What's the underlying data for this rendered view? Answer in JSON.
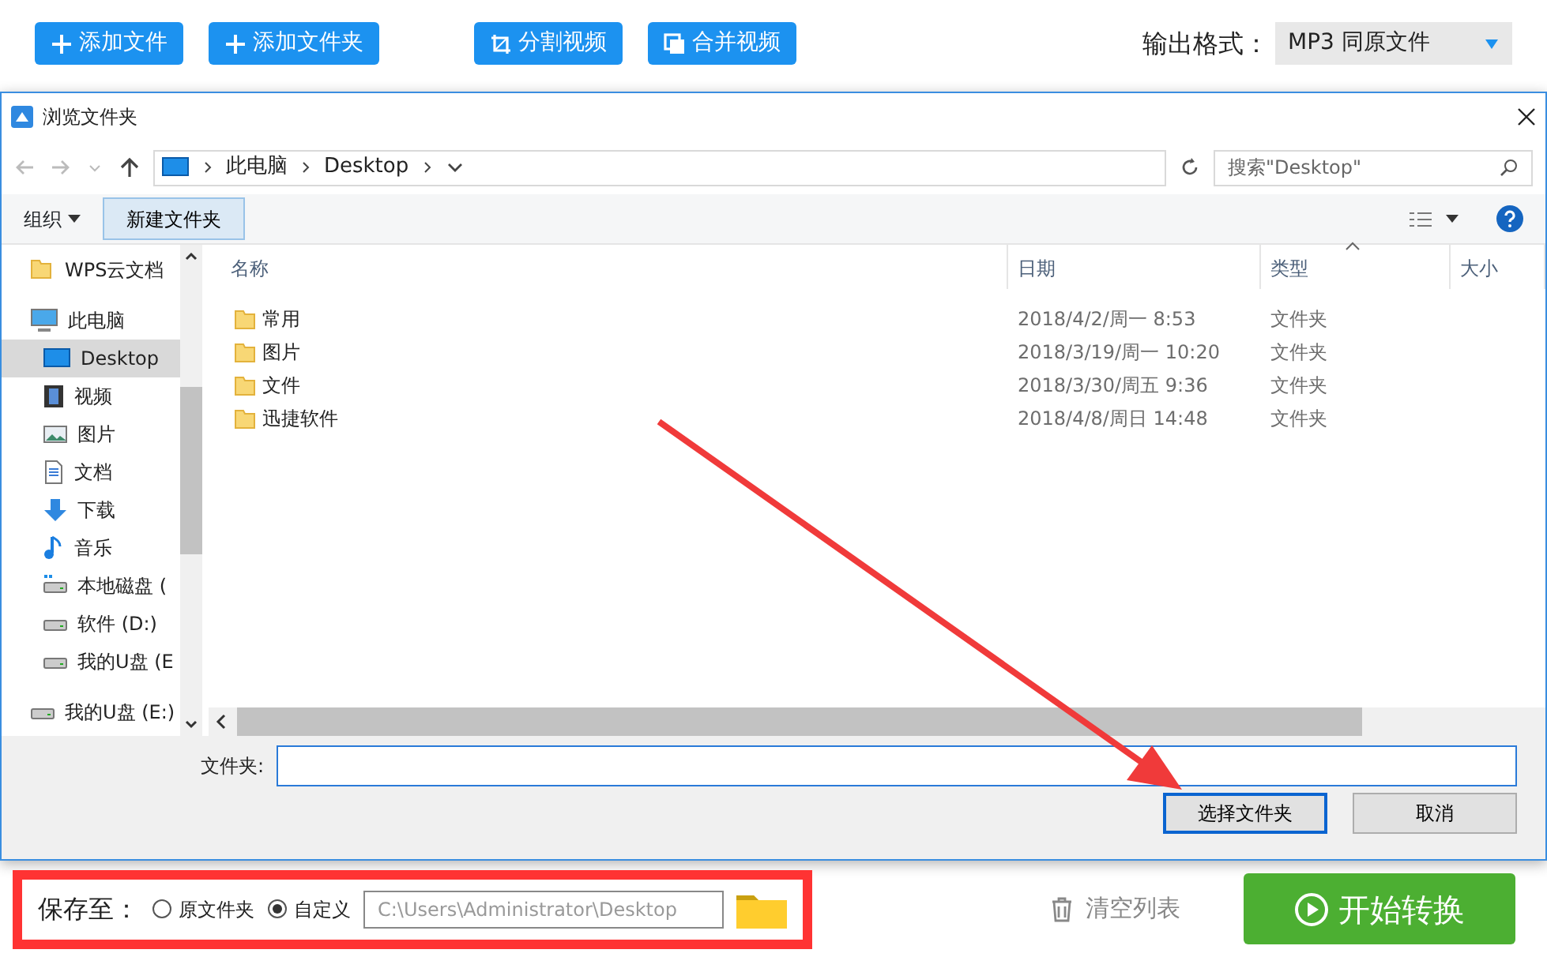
{
  "toolbar": {
    "buttons": [
      {
        "kind": "plus",
        "label": "添加文件"
      },
      {
        "kind": "plus",
        "label": "添加文件夹"
      },
      {
        "kind": "crop",
        "label": "分割视频"
      },
      {
        "kind": "merge",
        "label": "合并视频"
      }
    ],
    "output_format": {
      "label": "输出格式：",
      "value": "MP3  同原文件"
    }
  },
  "dialog": {
    "title": "浏览文件夹",
    "address": [
      "此电脑",
      "Desktop"
    ],
    "search": {
      "placeholder": "搜索\"Desktop\""
    },
    "commands": [
      {
        "label": "组织",
        "kind": "menu"
      },
      {
        "label": "新建文件夹",
        "kind": "button"
      }
    ],
    "sidebar": {
      "items": [
        {
          "kind": "folder",
          "label": "WPS云文档",
          "selected": false
        },
        {
          "kind": "pc",
          "label": "此电脑",
          "selected": false,
          "children": [
            {
              "kind": "desktop",
              "label": "Desktop",
              "selected": true
            },
            {
              "kind": "video",
              "label": "视频",
              "selected": false
            },
            {
              "kind": "picture",
              "label": "图片",
              "selected": false
            },
            {
              "kind": "document",
              "label": "文档",
              "selected": false
            },
            {
              "kind": "download",
              "label": "下载",
              "selected": false
            },
            {
              "kind": "music",
              "label": "音乐",
              "selected": false
            },
            {
              "kind": "system-drive",
              "label": "本地磁盘 (",
              "selected": false
            },
            {
              "kind": "drive",
              "label": "软件 (D:)",
              "selected": false
            },
            {
              "kind": "drive",
              "label": "我的U盘 (E",
              "selected": false
            }
          ]
        },
        {
          "kind": "drive",
          "label": "我的U盘 (E:)",
          "selected": false
        }
      ]
    },
    "table": {
      "columns": [
        "名称",
        "日期",
        "类型",
        "大小"
      ],
      "rows": [
        {
          "name": "常用",
          "date": "2018/4/2/周一 8:53",
          "type": "文件夹"
        },
        {
          "name": "图片",
          "date": "2018/3/19/周一 10:20",
          "type": "文件夹"
        },
        {
          "name": "文件",
          "date": "2018/3/30/周五 9:36",
          "type": "文件夹"
        },
        {
          "name": "迅捷软件",
          "date": "2018/4/8/周日 14:48",
          "type": "文件夹"
        }
      ]
    },
    "folder_label": "文件夹:",
    "buttons": [
      {
        "label": "选择文件夹",
        "default": true
      },
      {
        "label": "取消",
        "default": false
      }
    ]
  },
  "save_to": {
    "label": "保存至：",
    "highlighted": true,
    "options": [
      {
        "label": "原文件夹",
        "selected": false
      },
      {
        "label": "自定义",
        "selected": true
      }
    ],
    "path": "C:\\Users\\Administrator\\Desktop"
  },
  "clear_list": "清空列表",
  "start": "开始转换"
}
